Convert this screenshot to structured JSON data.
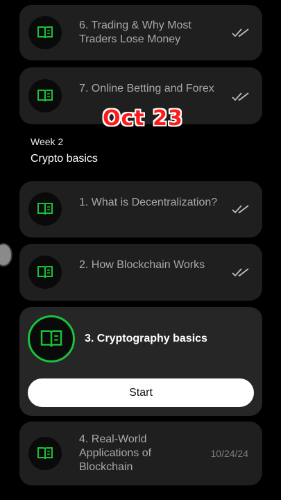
{
  "overlay": {
    "date_stamp": "Oct 23"
  },
  "week": {
    "label": "Week 2",
    "title": "Crypto basics"
  },
  "previous_lessons": [
    {
      "title": "6. Trading & Why Most Traders Lose Money"
    },
    {
      "title": "7. Online Betting and Forex"
    }
  ],
  "lessons": [
    {
      "title": "1. What is Decentralization?"
    },
    {
      "title": "2. How Blockchain Works"
    }
  ],
  "active_lesson": {
    "title": "3. Cryptography basics",
    "button": "Start"
  },
  "upcoming_lesson": {
    "title": "4. Real-World Applications of Blockchain",
    "date": "10/24/24"
  },
  "colors": {
    "accent": "#19c23a",
    "card": "#1f1f1f",
    "background": "#000000"
  }
}
